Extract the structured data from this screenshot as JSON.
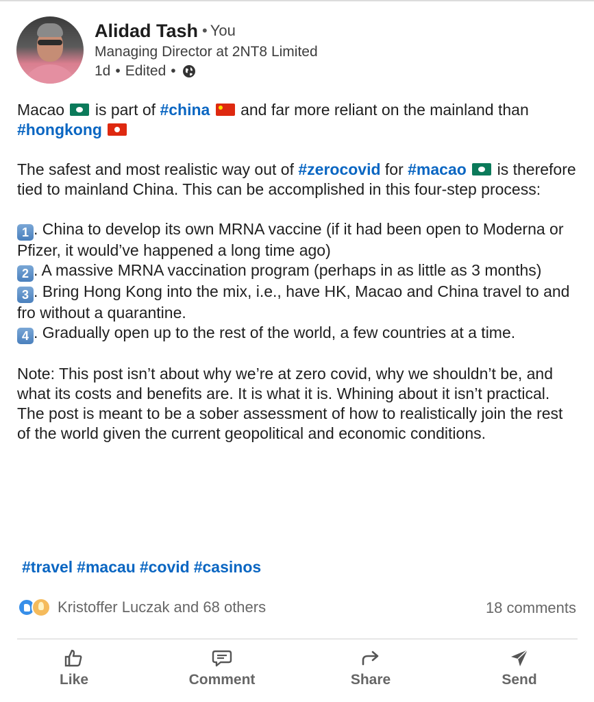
{
  "author": {
    "name": "Alidad Tash",
    "you_badge": "You",
    "headline": "Managing Director at 2NT8 Limited",
    "age": "1d",
    "edited": "Edited",
    "visibility_icon": "globe-icon"
  },
  "post": {
    "p1": {
      "a": "Macao",
      "b": "is part of",
      "tag1": "#china",
      "c": "and far more reliant on the mainland than",
      "tag2": "#hongkong"
    },
    "p2": {
      "a": "The safest and most realistic way out of",
      "tag1": "#zerocovid",
      "b": "for",
      "tag2": "#macao",
      "c": "is therefore tied to mainland China. This can be accomplished in this four-step process:"
    },
    "steps": [
      {
        "num": "1",
        "text": ". China to develop its own MRNA vaccine (if it had been open to Moderna or Pfizer, it would’ve happened a long time ago)"
      },
      {
        "num": "2",
        "text": ". A massive MRNA vaccination program (perhaps in as little as 3 months)"
      },
      {
        "num": "3",
        "text": ". Bring Hong Kong into the mix, i.e., have HK, Macao and China travel to and fro without a quarantine."
      },
      {
        "num": "4",
        "text": ". Gradually open up to the rest of the world, a few countries at a time."
      }
    ],
    "note": "Note: This post isn’t about why we’re at zero covid, why we shouldn’t be, and what its costs and benefits are. It is what it is. Whining about it isn’t practical. The post is meant to be a sober assessment of how to realistically join the rest of the world given the current geopolitical and economic conditions."
  },
  "hashtags": [
    "#travel",
    "#macau",
    "#covid",
    "#casinos"
  ],
  "social": {
    "reactions_text": "Kristoffer Luczak and 68 others",
    "comments_text": "18 comments"
  },
  "actions": {
    "like": "Like",
    "comment": "Comment",
    "share": "Share",
    "send": "Send"
  },
  "colors": {
    "hashtag": "#0a66c2",
    "muted_text": "#666666"
  }
}
